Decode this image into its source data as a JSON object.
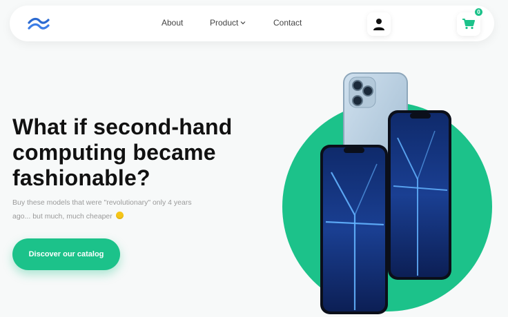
{
  "nav": {
    "links": [
      {
        "label": "About"
      },
      {
        "label": "Product"
      },
      {
        "label": "Contact"
      }
    ]
  },
  "header": {
    "cart_count": "0"
  },
  "hero": {
    "title": "What if second-hand computing became fashionable?",
    "subtitle": "Buy these models that were \"revolutionary\" only 4 years ago... but much, much cheaper",
    "cta_label": "Discover our catalog"
  },
  "colors": {
    "accent": "#1cc28a",
    "logo": "#2b6ad0",
    "text": "#111111",
    "muted": "#9a9a9a"
  },
  "icons": {
    "logo": "wave-logo-icon",
    "user": "user-icon",
    "cart": "cart-icon",
    "chevron": "chevron-down-icon"
  }
}
